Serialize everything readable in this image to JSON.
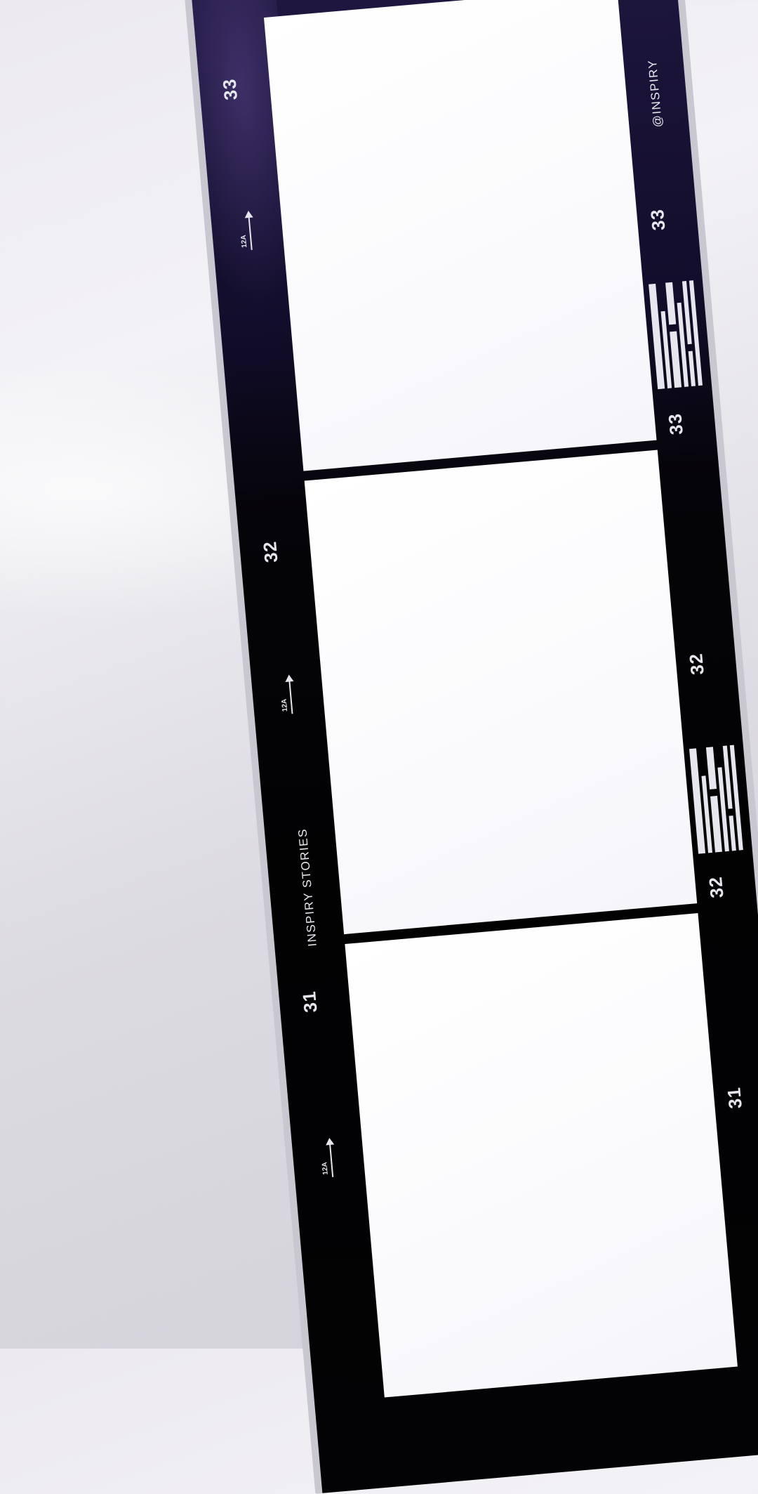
{
  "strip": {
    "left_marks": {
      "frame_numbers": [
        "33",
        "32",
        "31"
      ],
      "arrow_label": "12A",
      "brand_text": "INSPIRY  STORIES"
    },
    "right_marks": {
      "handle": "@INSPIRY",
      "numbers_top": [
        "33",
        "33"
      ],
      "numbers_mid": [
        "32",
        "32"
      ],
      "numbers_bottom": [
        "31"
      ]
    }
  },
  "icons": {
    "arrow": "arrow-up-icon",
    "barcode": "barcode-icon"
  },
  "colors": {
    "film": "#050408",
    "film_top": "#221a44",
    "frame": "#ffffff",
    "marks": "#e6e6ee",
    "background": "#e4e3e9"
  }
}
